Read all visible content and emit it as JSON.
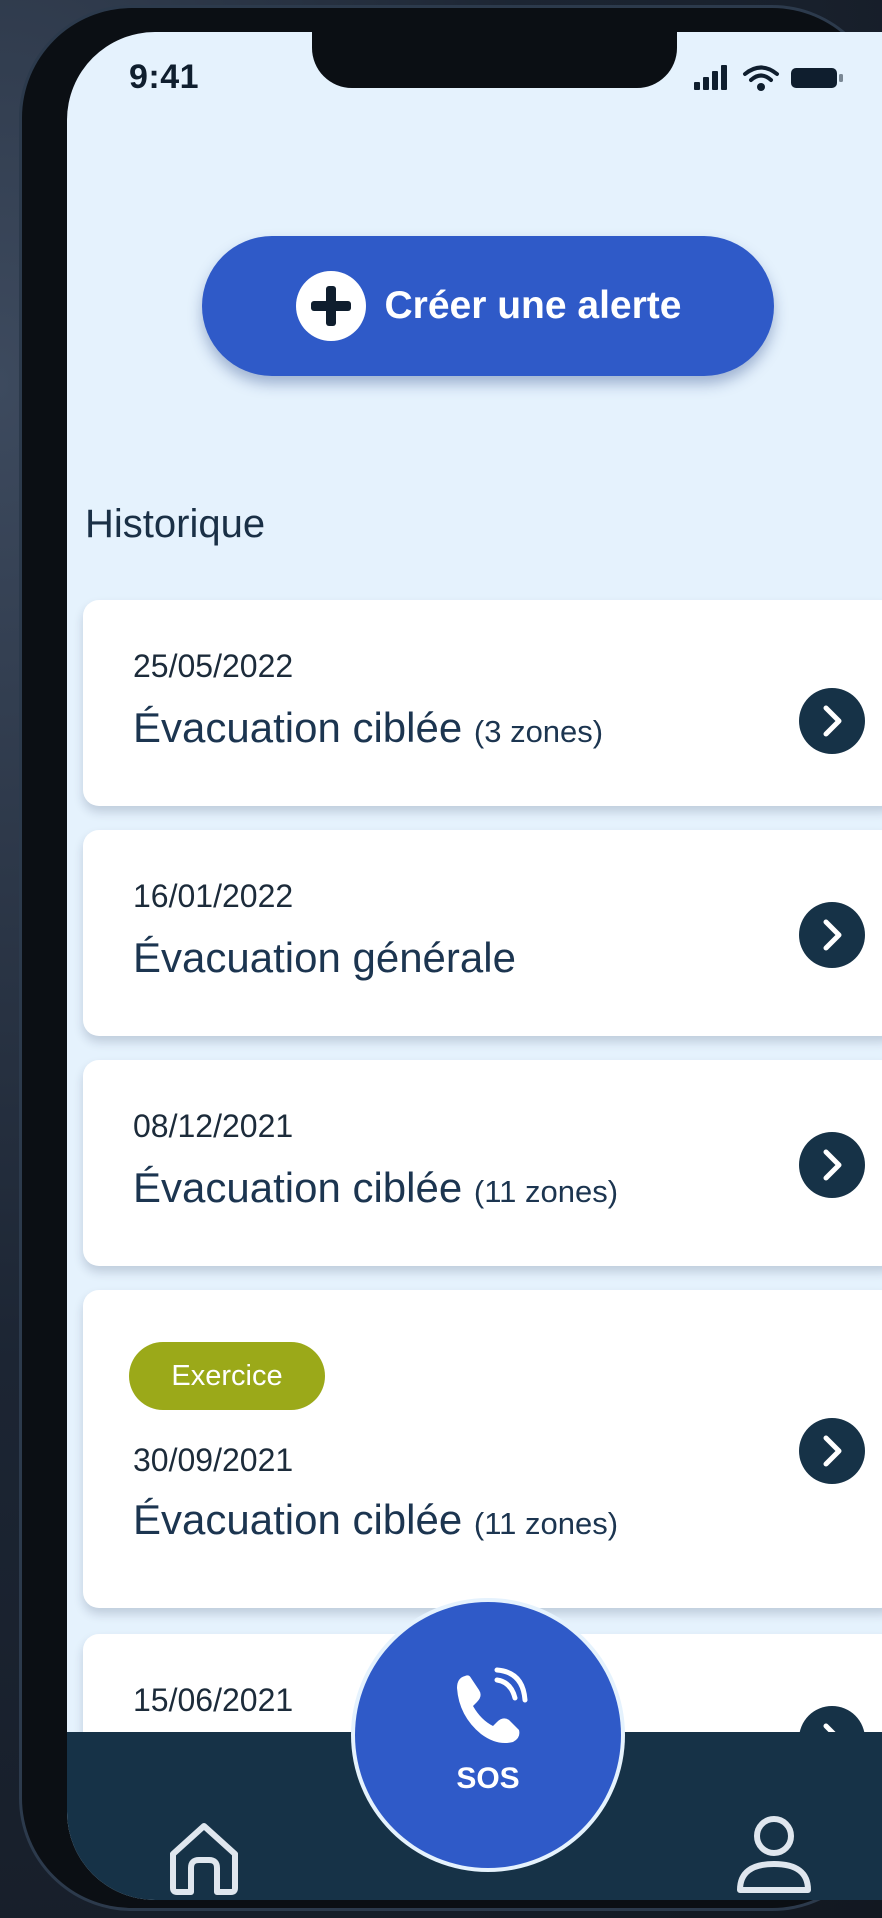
{
  "status_bar": {
    "time": "9:41"
  },
  "create_alert": {
    "label": "Créer une alerte"
  },
  "history": {
    "title": "Historique",
    "items": [
      {
        "date": "25/05/2022",
        "title": "Évacuation ciblée",
        "zones": "(3 zones)"
      },
      {
        "date": "16/01/2022",
        "title": "Évacuation générale",
        "zones": ""
      },
      {
        "date": "08/12/2021",
        "title": "Évacuation ciblée",
        "zones": "(11 zones)"
      },
      {
        "badge": "Exercice",
        "date": "30/09/2021",
        "title": "Évacuation ciblée",
        "zones": "(11 zones)"
      },
      {
        "date": "15/06/2021",
        "title": "",
        "zones": ""
      }
    ]
  },
  "tab_bar": {
    "sos_label": "SOS",
    "home_icon": "home-icon",
    "profile_icon": "user-icon"
  },
  "colors": {
    "primary": "#2f5ac8",
    "navy": "#163247",
    "screen_bg": "#e5f2fd",
    "badge": "#9ba919"
  }
}
